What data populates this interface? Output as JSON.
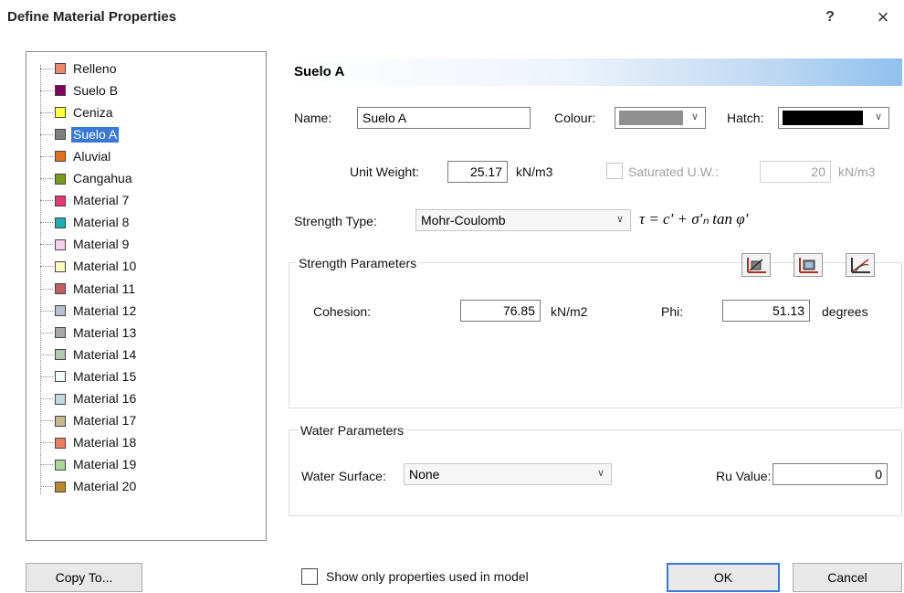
{
  "window": {
    "title": "Define Material Properties",
    "help": "?",
    "close": "×"
  },
  "materials": [
    {
      "label": "Relleno",
      "color": "#e98a6a"
    },
    {
      "label": "Suelo B",
      "color": "#800060"
    },
    {
      "label": "Ceniza",
      "color": "#ffff40"
    },
    {
      "label": "Suelo A",
      "color": "#808080",
      "selected": true
    },
    {
      "label": "Aluvial",
      "color": "#e07020"
    },
    {
      "label": "Cangahua",
      "color": "#7a9a20"
    },
    {
      "label": "Material 7",
      "color": "#e03a78"
    },
    {
      "label": "Material 8",
      "color": "#20b0b0"
    },
    {
      "label": "Material 9",
      "color": "#f8d0f0"
    },
    {
      "label": "Material 10",
      "color": "#fff8c0"
    },
    {
      "label": "Material 11",
      "color": "#c06060"
    },
    {
      "label": "Material 12",
      "color": "#b8c0d0"
    },
    {
      "label": "Material 13",
      "color": "#a8a8a8"
    },
    {
      "label": "Material 14",
      "color": "#b0c8b0"
    },
    {
      "label": "Material 15",
      "color": "#f0f8f8"
    },
    {
      "label": "Material 16",
      "color": "#c0dce0"
    },
    {
      "label": "Material 17",
      "color": "#c8b890"
    },
    {
      "label": "Material 18",
      "color": "#e88060"
    },
    {
      "label": "Material 19",
      "color": "#a8d898"
    },
    {
      "label": "Material 20",
      "color": "#b88a30"
    }
  ],
  "detail": {
    "title": "Suelo A",
    "name_label": "Name:",
    "name_value": "Suelo A",
    "colour_label": "Colour:",
    "colour_value": "#909090",
    "hatch_label": "Hatch:",
    "hatch_value": "#000000",
    "unit_weight_label": "Unit Weight:",
    "unit_weight_value": "25.17",
    "unit_weight_unit": "kN/m3",
    "saturated_label": "Saturated U.W.:",
    "saturated_value": "20",
    "saturated_unit": "kN/m3",
    "strength_type_label": "Strength Type:",
    "strength_type_value": "Mohr-Coulomb",
    "formula": "τ = c' + σ'ₙ tan φ'",
    "strength_group": "Strength Parameters",
    "cohesion_label": "Cohesion:",
    "cohesion_value": "76.85",
    "cohesion_unit": "kN/m2",
    "phi_label": "Phi:",
    "phi_value": "51.13",
    "phi_unit": "degrees",
    "water_group": "Water Parameters",
    "water_surface_label": "Water Surface:",
    "water_surface_value": "None",
    "ru_label": "Ru Value:",
    "ru_value": "0"
  },
  "footer": {
    "copy_to": "Copy To...",
    "show_only_label": "Show only properties used in model",
    "ok": "OK",
    "cancel": "Cancel"
  }
}
